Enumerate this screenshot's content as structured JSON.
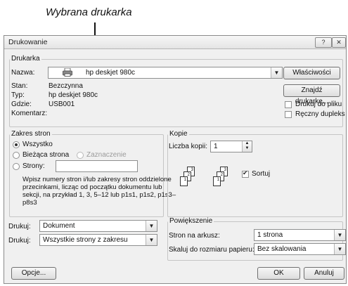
{
  "callout": "Wybrana drukarka",
  "window": {
    "title": "Drukowanie",
    "help_btn": "?",
    "close_btn": "✕"
  },
  "printer": {
    "group_label": "Drukarka",
    "name_label": "Nazwa:",
    "name_value": "hp deskjet 980c",
    "status_label": "Stan:",
    "status_value": "Bezczynna",
    "type_label": "Typ:",
    "type_value": "hp deskjet 980c",
    "where_label": "Gdzie:",
    "where_value": "USB001",
    "comment_label": "Komentarz:",
    "properties_button": "Właściwości",
    "find_button": "Znajdź drukarkę...",
    "print_to_file": "Drukuj do pliku",
    "manual_duplex": "Ręczny dupleks"
  },
  "range": {
    "group_label": "Zakres stron",
    "all": "Wszystko",
    "current": "Bieżąca strona",
    "selection": "Zaznaczenie",
    "pages": "Strony:",
    "help": "Wpisz numery stron i/lub zakresy stron oddzielone przecinkami, licząc od początku dokumentu lub sekcji, na przykład 1, 3, 5–12 lub p1s1, p1s2, p1s3–p8s3"
  },
  "copies": {
    "group_label": "Kopie",
    "count_label": "Liczba kopii:",
    "count_value": "1",
    "collate": "Sortuj",
    "page_numbers": [
      "1",
      "2",
      "3"
    ]
  },
  "print_what": {
    "label": "Drukuj:",
    "value": "Dokument"
  },
  "print_scope": {
    "label": "Drukuj:",
    "value": "Wszystkie strony z zakresu"
  },
  "zoom": {
    "group_label": "Powiększenie",
    "pages_per_sheet_label": "Stron na arkusz:",
    "pages_per_sheet_value": "1 strona",
    "scale_label": "Skaluj do rozmiaru papieru:",
    "scale_value": "Bez skalowania"
  },
  "buttons": {
    "options": "Opcje...",
    "ok": "OK",
    "cancel": "Anuluj"
  }
}
